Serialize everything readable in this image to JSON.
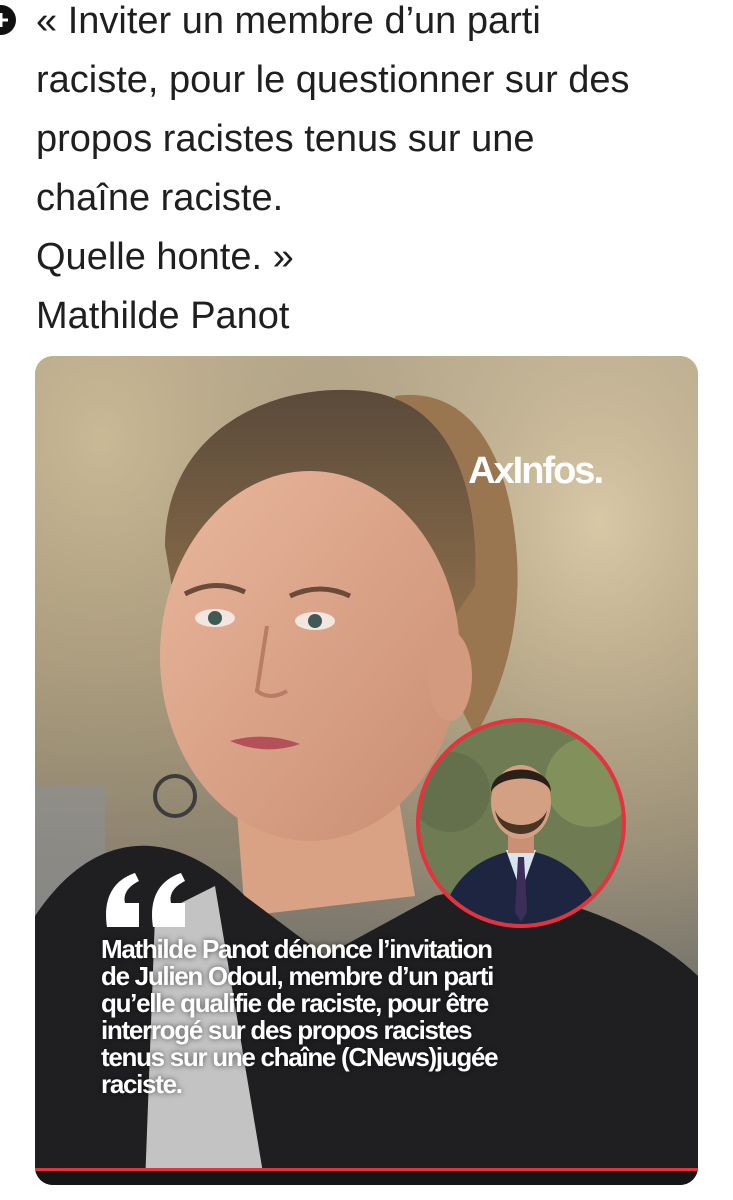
{
  "post": {
    "lines": [
      "« Inviter un membre d’un parti",
      "raciste, pour le questionner sur des",
      "propos racistes tenus sur une",
      "chaîne raciste.",
      "Quelle honte. »",
      "Mathilde Panot"
    ]
  },
  "card": {
    "brand": "AxInfos.",
    "caption_lines": [
      "Mathilde Panot dénonce l’invitation",
      "de Julien Odoul, membre d’un parti",
      "qu’elle qualifie de raciste, pour être",
      "interrogé sur des propos racistes",
      "tenus sur une chaîne (CNews)jugée",
      "raciste."
    ],
    "accent_color": "#e5323e"
  },
  "icons": {
    "expand": "plus-icon",
    "quote": "quote-mark-icon"
  }
}
